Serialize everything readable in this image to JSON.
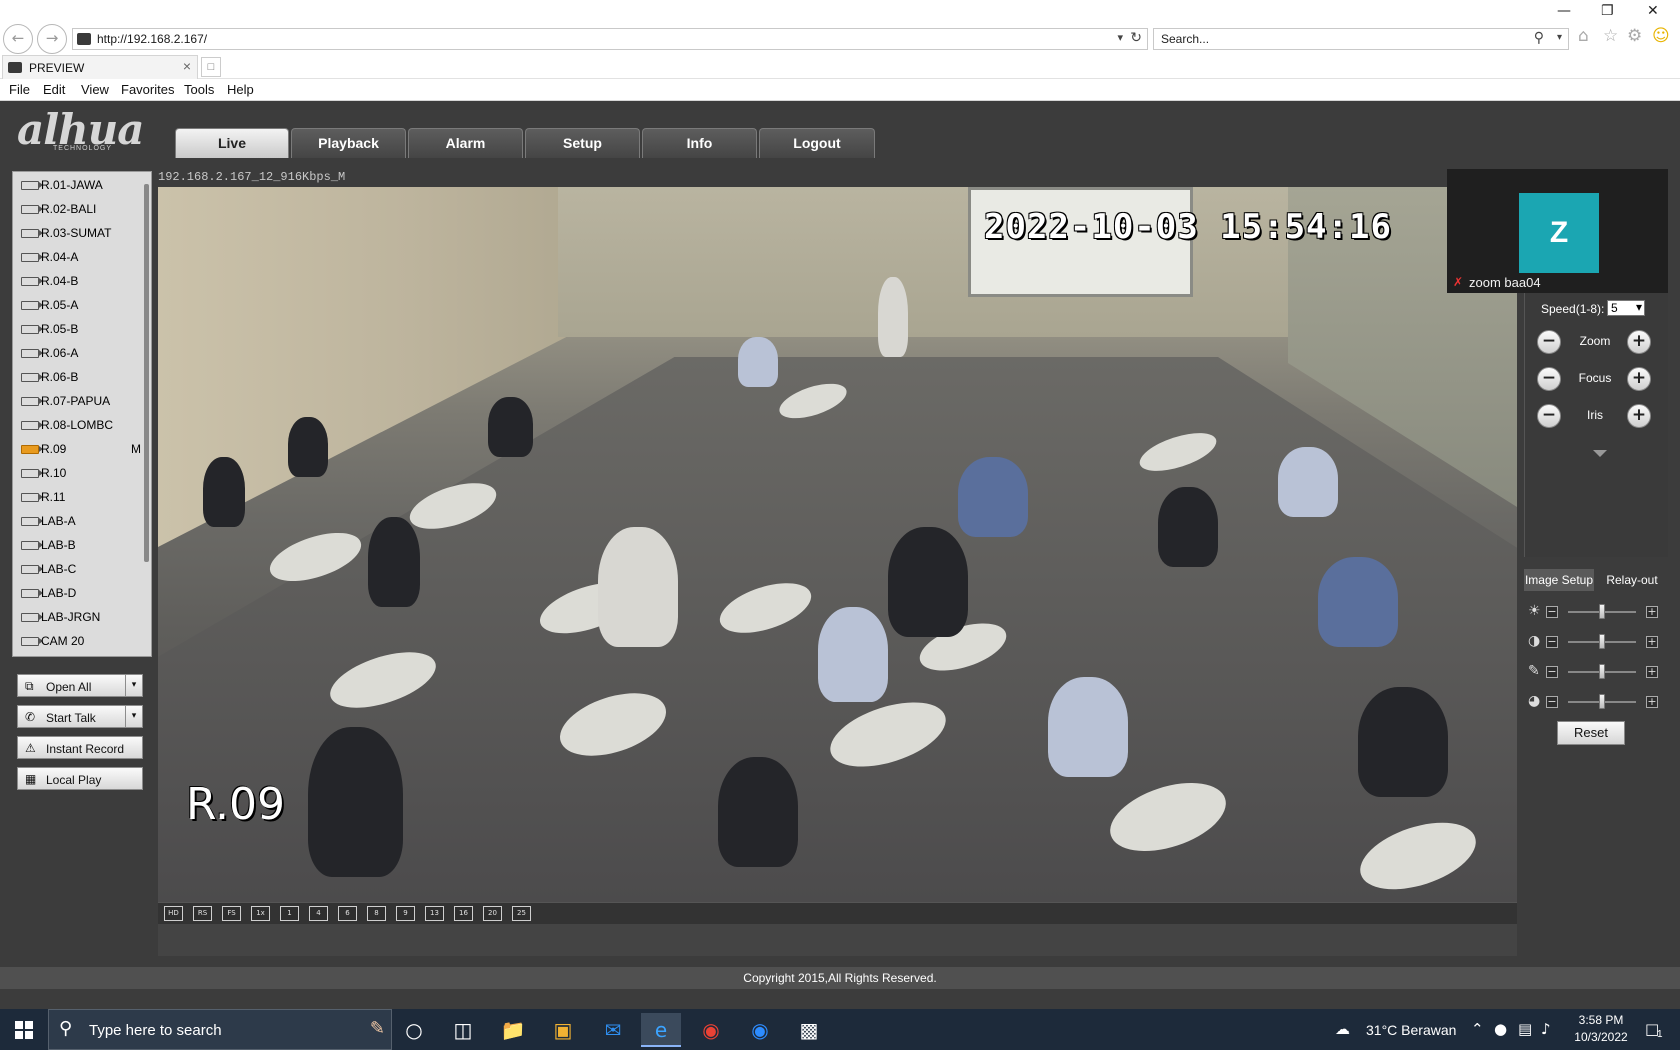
{
  "browser": {
    "url": "http://192.168.2.167/",
    "search_placeholder": "Search...",
    "tab_title": "PREVIEW",
    "menu": [
      "File",
      "Edit",
      "View",
      "Favorites",
      "Tools",
      "Help"
    ]
  },
  "app": {
    "logo": "alhua",
    "logo_sub": "TECHNOLOGY",
    "nav_tabs": [
      "Live",
      "Playback",
      "Alarm",
      "Setup",
      "Info",
      "Logout"
    ],
    "active_tab": "Live",
    "channels": [
      {
        "label": "R.01-JAWA",
        "mark": ""
      },
      {
        "label": "R.02-BALI",
        "mark": ""
      },
      {
        "label": "R.03-SUMAT",
        "mark": ""
      },
      {
        "label": "R.04-A",
        "mark": ""
      },
      {
        "label": "R.04-B",
        "mark": ""
      },
      {
        "label": "R.05-A",
        "mark": ""
      },
      {
        "label": "R.05-B",
        "mark": ""
      },
      {
        "label": "R.06-A",
        "mark": ""
      },
      {
        "label": "R.06-B",
        "mark": ""
      },
      {
        "label": "R.07-PAPUA",
        "mark": ""
      },
      {
        "label": "R.08-LOMBC",
        "mark": ""
      },
      {
        "label": "R.09",
        "mark": "M"
      },
      {
        "label": "R.10",
        "mark": ""
      },
      {
        "label": "R.11",
        "mark": ""
      },
      {
        "label": "LAB-A",
        "mark": ""
      },
      {
        "label": "LAB-B",
        "mark": ""
      },
      {
        "label": "LAB-C",
        "mark": ""
      },
      {
        "label": "LAB-D",
        "mark": ""
      },
      {
        "label": "LAB-JRGN",
        "mark": ""
      },
      {
        "label": "CAM 20",
        "mark": ""
      }
    ],
    "active_channel": "R.09",
    "actions": {
      "open_all": "Open All",
      "start_talk": "Start Talk",
      "instant_record": "Instant Record",
      "local_play": "Local Play"
    },
    "stream_label": "192.168.2.167_12_916Kbps_M",
    "video_timestamp": "2022-10-03 15:54:16",
    "video_overlay_name": "R.09",
    "video_toolbar": [
      "HD",
      "RS",
      "FS",
      "1x",
      "1",
      "4",
      "6",
      "8",
      "9",
      "13",
      "16",
      "20",
      "25"
    ],
    "zoom_overlay": {
      "initial": "Z",
      "name": "zoom baa04"
    },
    "ptz": {
      "speed_label": "Speed(1-8):",
      "speed_value": "5",
      "zoom_label": "Zoom",
      "focus_label": "Focus",
      "iris_label": "Iris"
    },
    "image_tabs": [
      "Image Setup",
      "Relay-out"
    ],
    "image_sliders": [
      {
        "name": "brightness",
        "icon": "sun-icon",
        "value": 0.5
      },
      {
        "name": "contrast",
        "icon": "contrast-icon",
        "value": 0.5
      },
      {
        "name": "saturation",
        "icon": "saturation-icon",
        "value": 0.5
      },
      {
        "name": "hue",
        "icon": "palette-icon",
        "value": 0.5
      }
    ],
    "reset_label": "Reset",
    "copyright": "Copyright 2015,All Rights Reserved."
  },
  "taskbar": {
    "search_placeholder": "Type here to search",
    "weather": "31°C  Berawan",
    "time": "3:58 PM",
    "date": "10/3/2022",
    "notification_count": "1"
  }
}
